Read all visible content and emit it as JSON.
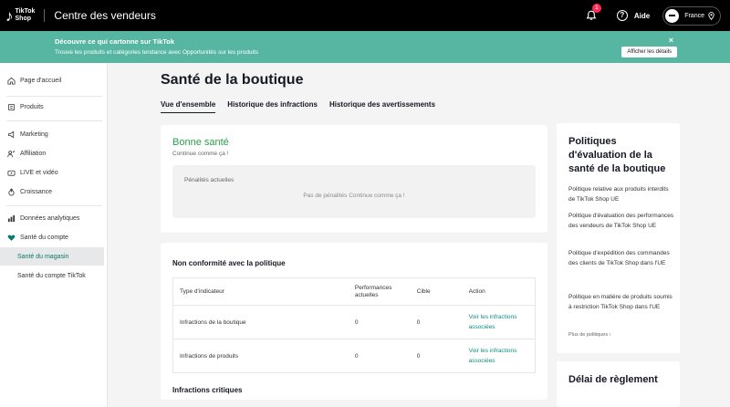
{
  "header": {
    "logo_line1": "TikTok",
    "logo_line2": "Shop",
    "title": "Centre des vendeurs",
    "notifications_count": "1",
    "help_label": "Aide",
    "region": "France"
  },
  "banner": {
    "title": "Découvre ce qui cartonne sur TikTok",
    "subtitle": "Trouve les produits et catégories tendance avec Opportunités sur les produits",
    "button_label": "Afficher les détails",
    "close_glyph": "×",
    "background_color": "#56b6a2"
  },
  "sidebar": {
    "items": [
      {
        "label": "Page d'accueil",
        "icon": "home-icon"
      },
      {
        "label": "Produits",
        "icon": "product-icon"
      },
      {
        "label": "Marketing",
        "icon": "megaphone-icon"
      },
      {
        "label": "Affiliation",
        "icon": "people-icon"
      },
      {
        "label": "LIVE et vidéo",
        "icon": "video-icon"
      },
      {
        "label": "Croissance",
        "icon": "growth-icon"
      },
      {
        "label": "Données analytiques",
        "icon": "chart-icon"
      },
      {
        "label": "Santé du compte",
        "icon": "heart-icon"
      },
      {
        "label": "Santé du magasin",
        "icon": ""
      },
      {
        "label": "Santé du compte TikTok",
        "icon": ""
      }
    ],
    "active_color": "#0a7a6e"
  },
  "main": {
    "title": "Santé de la boutique",
    "tabs": [
      "Vue d'ensemble",
      "Historique des infractions",
      "Historique des avertissements"
    ],
    "health": {
      "status": "Bonne santé",
      "status_sub": "Continue comme ça !",
      "penalties_label": "Pénalités actuelles",
      "penalties_text": "Pas de pénalités Continue comme ça !",
      "status_color": "#2ba14b"
    },
    "nonconformity": {
      "title": "Non conformité avec la politique",
      "columns": [
        "Type d'indicateur",
        "Performances actuelles",
        "Cible",
        "Action"
      ],
      "rows": [
        {
          "type": "Infractions de la boutique",
          "perf": "0",
          "target": "0",
          "action": "Voir les infractions associées"
        },
        {
          "type": "Infractions de produits",
          "perf": "0",
          "target": "0",
          "action": "Voir les infractions associées"
        }
      ],
      "critical_title": "Infractions critiques"
    }
  },
  "right_panel": {
    "title": "Politiques d'évaluation de la santé de la boutique",
    "links": [
      "Politique relative aux produits interdits de TikTok Shop UE",
      "Politique d'évaluation des performances des vendeurs de TikTok Shop UE",
      "Politique d'expédition des commandes des clients de TikTok Shop dans l'UE",
      "Politique en matière de produits soumis à restriction TikTok Shop dans l'UE"
    ],
    "more_label": "Plus de politiques",
    "settlement_title": "Délai de règlement"
  }
}
